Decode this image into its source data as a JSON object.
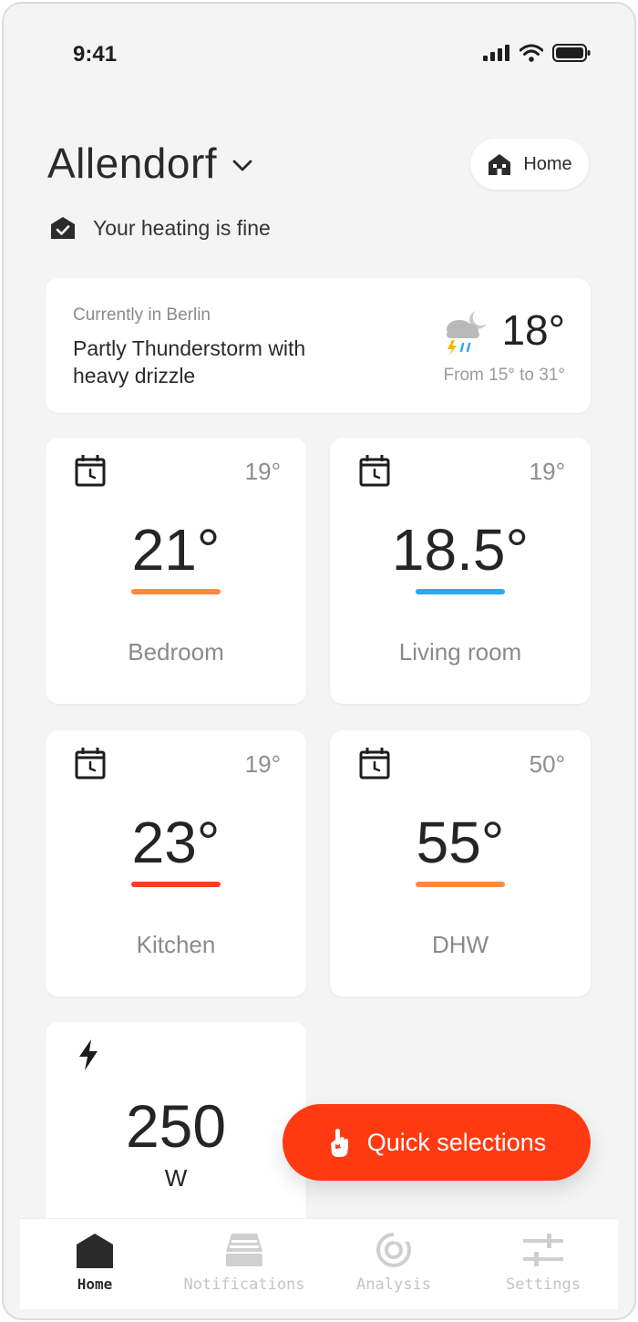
{
  "status_bar": {
    "time": "9:41"
  },
  "header": {
    "location": "Allendorf",
    "home_chip_label": "Home",
    "heating_status": "Your heating is fine"
  },
  "weather": {
    "subtitle": "Currently in Berlin",
    "description": "Partly Thunderstorm with heavy drizzle",
    "temperature": "18°",
    "range": "From 15° to 31°",
    "icon": "thunderstorm-night-icon"
  },
  "rooms": [
    {
      "name": "Bedroom",
      "temp": "21°",
      "setpoint": "19°",
      "bar_color": "#ff8a3d",
      "icon": "schedule-icon"
    },
    {
      "name": "Living room",
      "temp": "18.5°",
      "setpoint": "19°",
      "bar_color": "#2aa8f2",
      "icon": "schedule-icon"
    },
    {
      "name": "Kitchen",
      "temp": "23°",
      "setpoint": "19°",
      "bar_color": "#f2401c",
      "icon": "schedule-icon"
    },
    {
      "name": "DHW",
      "temp": "55°",
      "setpoint": "50°",
      "bar_color": "#ff8a3d",
      "icon": "schedule-icon"
    }
  ],
  "power": {
    "value": "250",
    "unit": "W",
    "icon": "bolt-icon"
  },
  "quick_selections": {
    "label": "Quick selections",
    "icon": "hand-pointer-icon",
    "color": "#ff3a12"
  },
  "nav": {
    "items": [
      {
        "label": "Home",
        "icon": "home-icon",
        "active": true
      },
      {
        "label": "Notifications",
        "icon": "notifications-icon",
        "active": false
      },
      {
        "label": "Analysis",
        "icon": "analysis-icon",
        "active": false
      },
      {
        "label": "Settings",
        "icon": "settings-sliders-icon",
        "active": false
      }
    ]
  }
}
